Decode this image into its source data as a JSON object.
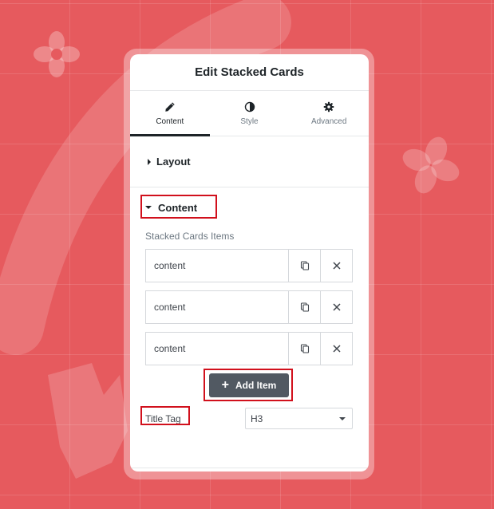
{
  "panel": {
    "title": "Edit Stacked Cards"
  },
  "tabs": [
    {
      "label": "Content",
      "icon": "pencil-icon",
      "active": true
    },
    {
      "label": "Style",
      "icon": "contrast-icon",
      "active": false
    },
    {
      "label": "Advanced",
      "icon": "gear-icon",
      "active": false
    }
  ],
  "sections": {
    "layout": {
      "title": "Layout",
      "expanded": false
    },
    "content": {
      "title": "Content",
      "expanded": true
    }
  },
  "repeater": {
    "label": "Stacked Cards Items",
    "items": [
      {
        "title": "content"
      },
      {
        "title": "content"
      },
      {
        "title": "content"
      }
    ],
    "add_label": "Add Item"
  },
  "title_tag": {
    "label": "Title Tag",
    "value": "H3"
  },
  "colors": {
    "background": "#e65a5e",
    "highlight": "#d1101c",
    "button": "#515962"
  }
}
